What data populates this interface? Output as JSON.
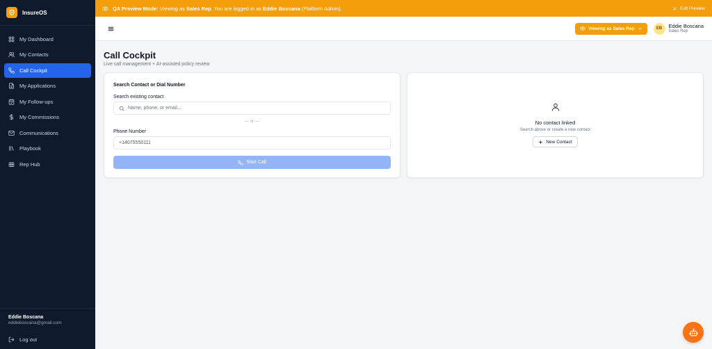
{
  "app": {
    "name": "InsureOS"
  },
  "sidebar": {
    "items": [
      {
        "label": "My Dashboard",
        "icon": "dashboard-icon"
      },
      {
        "label": "My Contacts",
        "icon": "contacts-icon"
      },
      {
        "label": "Call Cockpit",
        "icon": "phone-icon",
        "active": true
      },
      {
        "label": "My Applications",
        "icon": "file-icon"
      },
      {
        "label": "My Follow-ups",
        "icon": "calendar-icon"
      },
      {
        "label": "My Commissions",
        "icon": "dollar-icon"
      },
      {
        "label": "Communications",
        "icon": "mail-icon"
      },
      {
        "label": "Playbook",
        "icon": "books-icon"
      },
      {
        "label": "Rep Hub",
        "icon": "hub-icon"
      }
    ],
    "user": {
      "name": "Eddie Boscana",
      "email": "eddieboscana@gmail.com"
    },
    "logout_label": "Log out"
  },
  "banner": {
    "mode_label": "QA Preview Mode:",
    "viewing_as_prefix": "Viewing as",
    "viewing_role": "Sales Rep",
    "logged_in_prefix": ". You are logged in as",
    "logged_in_name": "Eddie Boscana",
    "logged_in_suffix": "(Platform Admin).",
    "exit_label": "Exit Preview"
  },
  "topbar": {
    "viewing_button": "Viewing as Sales Rep",
    "avatar_initials": "EB",
    "user_name": "Eddie Boscana",
    "user_role": "Sales Rep"
  },
  "page": {
    "title": "Call Cockpit",
    "subtitle": "Live call management + AI-assisted policy review"
  },
  "dial_card": {
    "title": "Search Contact or Dial Number",
    "search_label": "Search existing contact",
    "search_placeholder": "Name, phone, or email...",
    "or_text": "— or —",
    "phone_label": "Phone Number",
    "phone_value": "+14075550111",
    "start_call_label": "Start Call"
  },
  "contact_card": {
    "empty_title": "No contact linked",
    "empty_subtitle": "Search above or create a new contact",
    "new_contact_label": "New Contact"
  },
  "colors": {
    "sidebar_bg": "#0f1b2d",
    "accent_blue": "#2563eb",
    "banner_amber": "#f59e0b",
    "bot_orange": "#f97316"
  }
}
